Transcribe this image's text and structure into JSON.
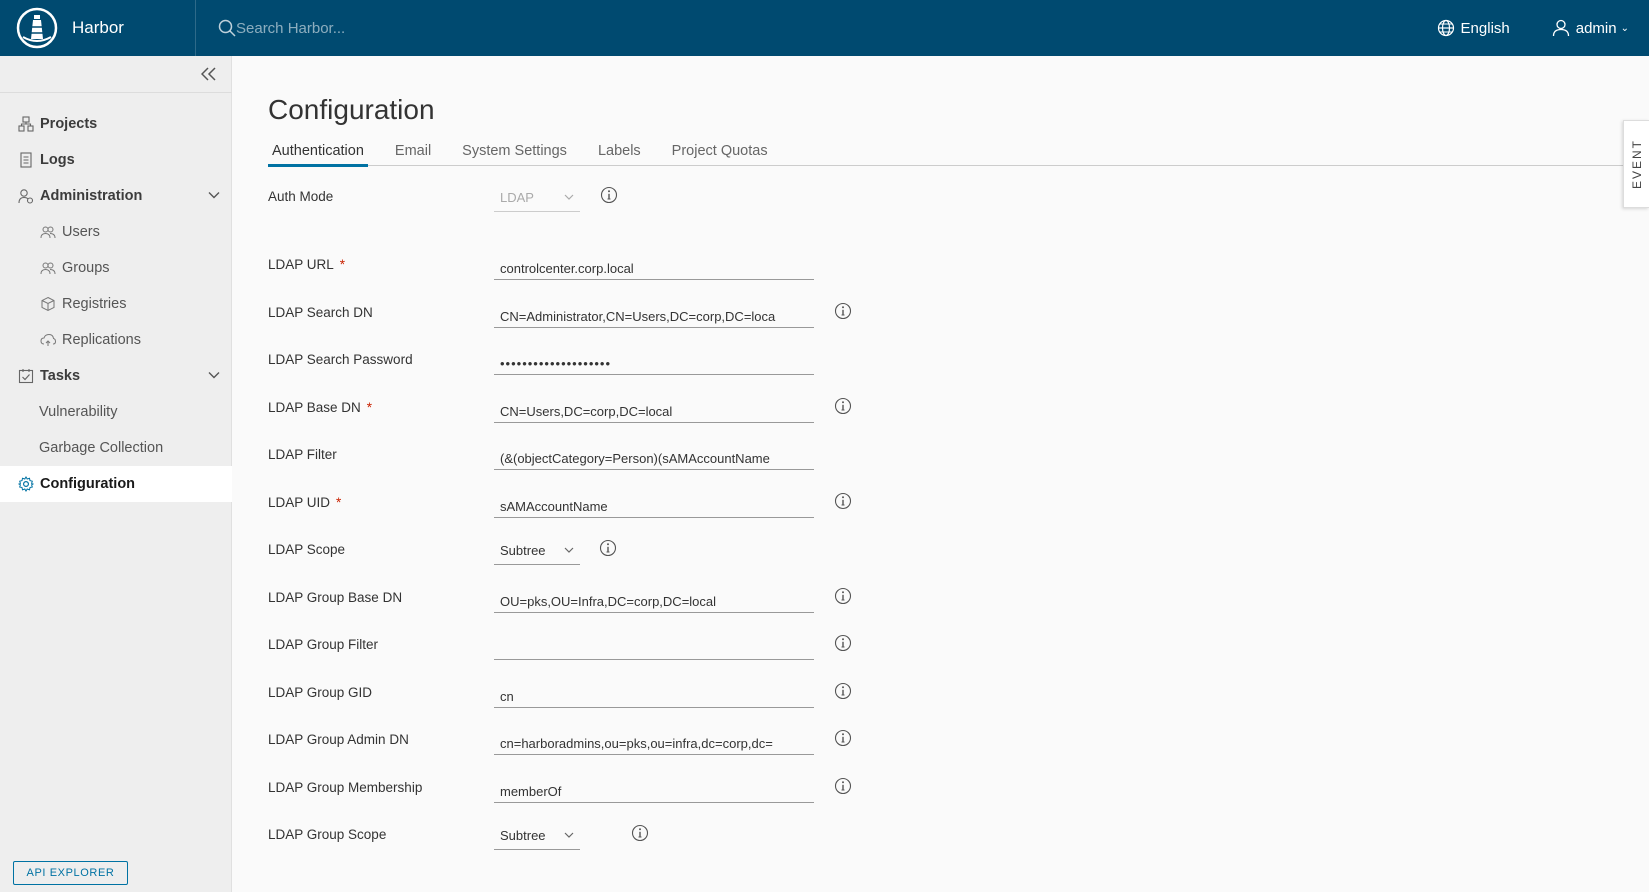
{
  "header": {
    "brand": "Harbor",
    "search_placeholder": "Search Harbor...",
    "language": "English",
    "user": "admin"
  },
  "sidebar": {
    "items": [
      {
        "label": "Projects"
      },
      {
        "label": "Logs"
      },
      {
        "label": "Administration"
      },
      {
        "label": "Users"
      },
      {
        "label": "Groups"
      },
      {
        "label": "Registries"
      },
      {
        "label": "Replications"
      },
      {
        "label": "Tasks"
      },
      {
        "label": "Vulnerability"
      },
      {
        "label": "Garbage Collection"
      },
      {
        "label": "Configuration"
      }
    ],
    "api_explorer": "API EXPLORER"
  },
  "main": {
    "title": "Configuration",
    "tabs": [
      {
        "label": "Authentication"
      },
      {
        "label": "Email"
      },
      {
        "label": "System Settings"
      },
      {
        "label": "Labels"
      },
      {
        "label": "Project Quotas"
      }
    ],
    "form": {
      "auth_mode": {
        "label": "Auth Mode",
        "value": "LDAP"
      },
      "ldap_url": {
        "label": "LDAP URL",
        "value": "controlcenter.corp.local"
      },
      "ldap_search_dn": {
        "label": "LDAP Search DN",
        "value": "CN=Administrator,CN=Users,DC=corp,DC=loca"
      },
      "ldap_search_password": {
        "label": "LDAP Search Password",
        "value": "••••••••••••••••••••"
      },
      "ldap_base_dn": {
        "label": "LDAP Base DN",
        "value": "CN=Users,DC=corp,DC=local"
      },
      "ldap_filter": {
        "label": "LDAP Filter",
        "value": "(&(objectCategory=Person)(sAMAccountName"
      },
      "ldap_uid": {
        "label": "LDAP UID",
        "value": "sAMAccountName"
      },
      "ldap_scope": {
        "label": "LDAP Scope",
        "value": "Subtree"
      },
      "ldap_group_base_dn": {
        "label": "LDAP Group Base DN",
        "value": "OU=pks,OU=Infra,DC=corp,DC=local"
      },
      "ldap_group_filter": {
        "label": "LDAP Group Filter",
        "value": ""
      },
      "ldap_group_gid": {
        "label": "LDAP Group GID",
        "value": "cn"
      },
      "ldap_group_admin_dn": {
        "label": "LDAP Group Admin DN",
        "value": "cn=harboradmins,ou=pks,ou=infra,dc=corp,dc="
      },
      "ldap_group_membership": {
        "label": "LDAP Group Membership",
        "value": "memberOf"
      },
      "ldap_group_scope": {
        "label": "LDAP Group Scope",
        "value": "Subtree"
      },
      "required_marker": "*"
    }
  },
  "event_tab": "EVENT",
  "colors": {
    "header_bg": "#004a70",
    "accent": "#0072a3",
    "required": "#c92100"
  }
}
